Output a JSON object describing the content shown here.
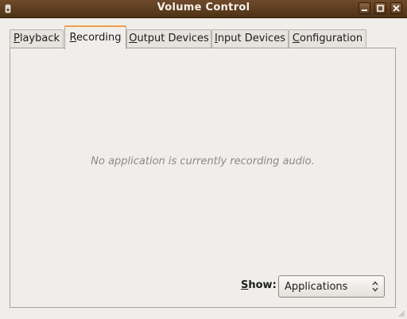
{
  "window": {
    "title": "Volume Control",
    "icons": {
      "app": "speaker-icon",
      "minimize": "minimize-icon",
      "maximize": "maximize-icon",
      "close": "close-icon"
    }
  },
  "tabs": [
    {
      "label": "Playback",
      "mnemonic": "P",
      "rest": "layback",
      "active": false
    },
    {
      "label": "Recording",
      "mnemonic": "R",
      "rest": "ecording",
      "active": true
    },
    {
      "label": "Output Devices",
      "mnemonic": "O",
      "rest": "utput Devices",
      "active": false
    },
    {
      "label": "Input Devices",
      "mnemonic": "I",
      "rest": "nput Devices",
      "active": false
    },
    {
      "label": "Configuration",
      "mnemonic": "C",
      "rest": "onfiguration",
      "active": false
    }
  ],
  "recording": {
    "empty_message": "No application is currently recording audio.",
    "show_label_mnemonic": "S",
    "show_label_rest": "how:",
    "show_value": "Applications"
  },
  "colors": {
    "titlebar": "#5c3c1f",
    "accent": "#f0a04a",
    "background": "#f0eeeb"
  }
}
